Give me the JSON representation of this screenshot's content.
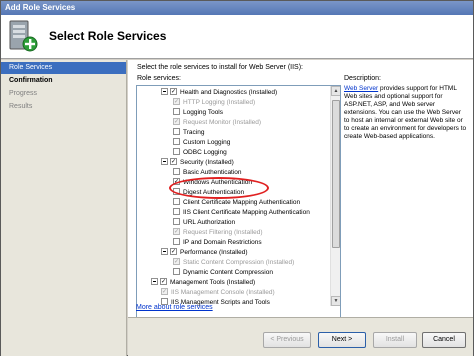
{
  "window": {
    "title": "Add Role Services"
  },
  "header": {
    "title": "Select Role Services"
  },
  "nav": {
    "items": [
      {
        "label": "Role Services",
        "state": "active"
      },
      {
        "label": "Confirmation",
        "state": "bold"
      },
      {
        "label": "Progress",
        "state": "disabled"
      },
      {
        "label": "Results",
        "state": "disabled"
      }
    ]
  },
  "main": {
    "instruction": "Select the role services to install for Web Server (IIS):",
    "role_services_label": "Role services:",
    "tree": [
      {
        "label": "Health and Diagnostics  (Installed)",
        "level": 1,
        "type": "group",
        "checked": "full",
        "disabled": false
      },
      {
        "label": "HTTP Logging  (Installed)",
        "level": 2,
        "type": "item",
        "checked": "gray",
        "disabled": true
      },
      {
        "label": "Logging Tools",
        "level": 2,
        "type": "item",
        "checked": "none",
        "disabled": false
      },
      {
        "label": "Request Monitor  (Installed)",
        "level": 2,
        "type": "item",
        "checked": "gray",
        "disabled": true
      },
      {
        "label": "Tracing",
        "level": 2,
        "type": "item",
        "checked": "none",
        "disabled": false
      },
      {
        "label": "Custom Logging",
        "level": 2,
        "type": "item",
        "checked": "none",
        "disabled": false
      },
      {
        "label": "ODBC Logging",
        "level": 2,
        "type": "item",
        "checked": "none",
        "disabled": false
      },
      {
        "label": "Security  (Installed)",
        "level": 1,
        "type": "group",
        "checked": "full",
        "disabled": false
      },
      {
        "label": "Basic Authentication",
        "level": 2,
        "type": "item",
        "checked": "none",
        "disabled": false
      },
      {
        "label": "Windows Authentication",
        "level": 2,
        "type": "item",
        "checked": "full",
        "disabled": false
      },
      {
        "label": "Digest Authentication",
        "level": 2,
        "type": "item",
        "checked": "none",
        "disabled": false
      },
      {
        "label": "Client Certificate Mapping Authentication",
        "level": 2,
        "type": "item",
        "checked": "none",
        "disabled": false
      },
      {
        "label": "IIS Client Certificate Mapping Authentication",
        "level": 2,
        "type": "item",
        "checked": "none",
        "disabled": false
      },
      {
        "label": "URL Authorization",
        "level": 2,
        "type": "item",
        "checked": "none",
        "disabled": false
      },
      {
        "label": "Request Filtering  (Installed)",
        "level": 2,
        "type": "item",
        "checked": "gray",
        "disabled": true
      },
      {
        "label": "IP and Domain Restrictions",
        "level": 2,
        "type": "item",
        "checked": "none",
        "disabled": false
      },
      {
        "label": "Performance  (Installed)",
        "level": 1,
        "type": "group",
        "checked": "full",
        "disabled": false
      },
      {
        "label": "Static Content Compression  (Installed)",
        "level": 2,
        "type": "item",
        "checked": "gray",
        "disabled": true
      },
      {
        "label": "Dynamic Content Compression",
        "level": 2,
        "type": "item",
        "checked": "none",
        "disabled": false
      },
      {
        "label": "Management Tools  (Installed)",
        "level": 0,
        "type": "group",
        "checked": "full",
        "disabled": false
      },
      {
        "label": "IIS Management Console  (Installed)",
        "level": 1,
        "type": "item",
        "checked": "gray",
        "disabled": true
      },
      {
        "label": "IIS Management Scripts and Tools",
        "level": 1,
        "type": "item",
        "checked": "none",
        "disabled": false
      }
    ],
    "more_link": "More about role services",
    "description_label": "Description:",
    "description_link": "Web Server",
    "description_text": " provides support for HTML Web sites and optional support for ASP.NET, ASP, and Web server extensions. You can use the Web Server to host an internal or external Web site or to create an environment for developers to create Web-based applications."
  },
  "footer": {
    "previous_label": "< Previous",
    "next_label": "Next >",
    "install_label": "Install",
    "cancel_label": "Cancel"
  },
  "icons": {
    "header_icon": "server-add-icon",
    "check": "checkmark-icon",
    "expander": "collapse-minus-icon"
  },
  "colors": {
    "title_bar": "#5577b5",
    "nav_active": "#3b6ebf",
    "link": "#0033cc",
    "annotation": "#e02020"
  }
}
